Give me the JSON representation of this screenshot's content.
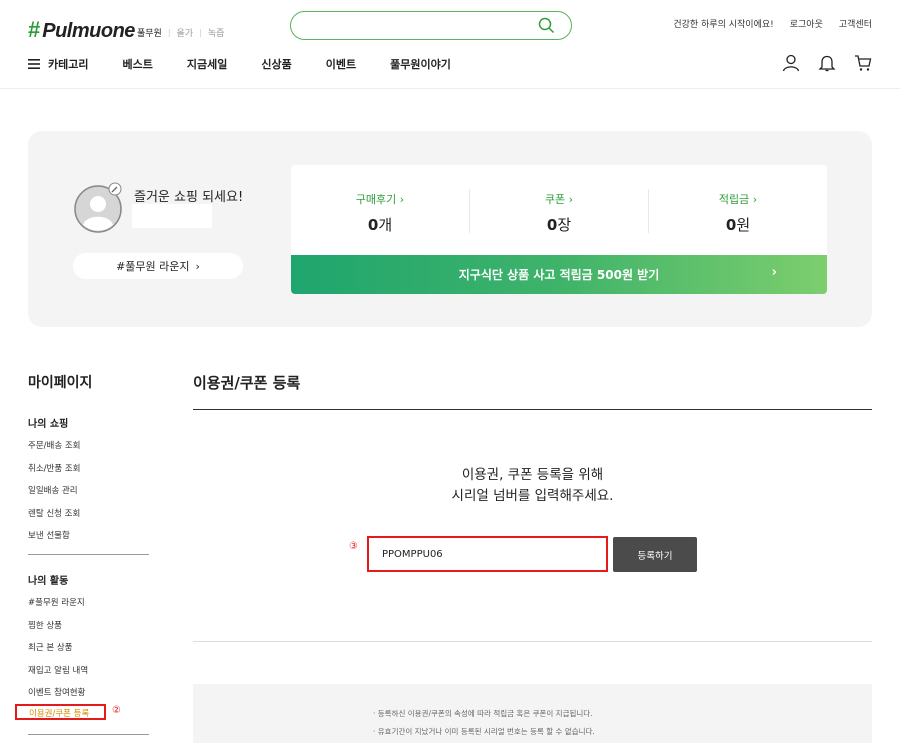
{
  "header": {
    "logo_mark": "#",
    "logo_text": "Pulmuone",
    "brand_links": [
      "풀무원",
      "올가",
      "녹즙"
    ],
    "search_placeholder": "",
    "util_links": [
      "건강한 하루의 시작이에요!",
      "로그아웃",
      "고객센터"
    ],
    "menu_label": "카테고리",
    "nav": [
      "베스트",
      "지금세일",
      "신상품",
      "이벤트",
      "풀무원이야기"
    ]
  },
  "profile": {
    "greeting": "즐거운 쇼핑 되세요!",
    "lounge_label": "#풀무원 라운지",
    "stats": [
      {
        "label": "구매후기",
        "value": "0",
        "unit": "개"
      },
      {
        "label": "쿠폰",
        "value": "0",
        "unit": "장"
      },
      {
        "label": "적립금",
        "value": "0",
        "unit": "원"
      }
    ],
    "banner": "지구식단 상품 사고 적립금 500원 받기"
  },
  "sidebar": {
    "title": "마이페이지",
    "groups": [
      {
        "title": "나의 쇼핑",
        "items": [
          "주문/배송 조회",
          "취소/반품 조회",
          "일일배송 관리",
          "렌탈 신청 조회",
          "보낸 선물함"
        ]
      },
      {
        "title": "나의 활동",
        "items": [
          "#풀무원 라운지",
          "찜한 상품",
          "최근 본 상품",
          "재입고 알림 내역",
          "이벤트 참여현황"
        ]
      }
    ],
    "active_item": "이용권/쿠폰 등록",
    "marker_2": "②"
  },
  "main": {
    "title": "이용권/쿠폰 등록",
    "desc_line1": "이용권, 쿠폰 등록을 위해",
    "desc_line2": "시리얼 넘버를 입력해주세요.",
    "marker_3": "③",
    "input_value": "PPOMPPU06",
    "register_label": "등록하기",
    "notices": [
      "· 등록하신 이용권/쿠폰의 속성에 따라 적립금 혹은 쿠폰이 지급됩니다.",
      "· 유효기간이 지났거나 이미 등록된 시리얼 번호는 등록 할 수 없습니다."
    ]
  },
  "colors": {
    "brand_green": "#2e9e3a",
    "highlight_red": "#e31b1b",
    "active_orange": "#e08a00"
  }
}
